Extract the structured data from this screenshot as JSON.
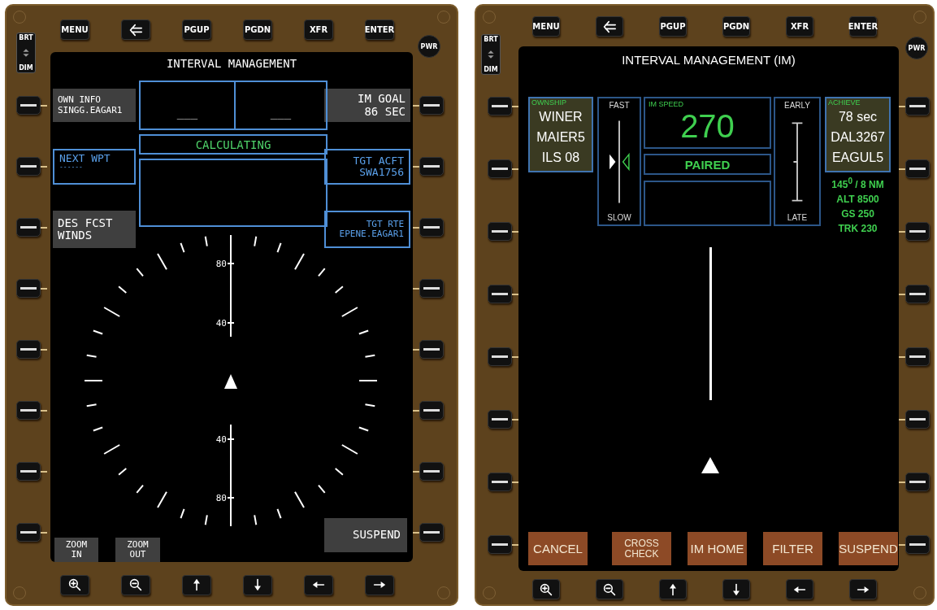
{
  "panels": [
    {
      "kind": "map",
      "brightness": [
        "BRT",
        "DIM"
      ],
      "power": "PWR",
      "top_keys": [
        {
          "kind": "text",
          "label": "MENU"
        },
        {
          "kind": "back"
        },
        {
          "kind": "text",
          "label": "PGUP"
        },
        {
          "kind": "text",
          "label": "PGDN"
        },
        {
          "kind": "text",
          "label": "XFR"
        },
        {
          "kind": "text",
          "label": "ENTER"
        }
      ],
      "bottom_keys": [
        {
          "kind": "zoom-in"
        },
        {
          "kind": "zoom-out"
        },
        {
          "kind": "up"
        },
        {
          "kind": "down"
        },
        {
          "kind": "left"
        },
        {
          "kind": "right"
        }
      ],
      "title": "INTERVAL MANAGEMENT",
      "left_labels": [
        {
          "kind": "filled",
          "lines": [
            "OWN INFO",
            "SINGG.EAGAR1"
          ]
        },
        {
          "kind": "outlined",
          "lines": [
            "NEXT WPT",
            "------"
          ]
        },
        {
          "kind": "filled",
          "lines": [
            "DES FCST",
            "WINDS"
          ]
        }
      ],
      "right_labels": [
        {
          "kind": "filled",
          "lines": [
            "IM GOAL",
            "86 SEC"
          ]
        },
        {
          "kind": "outlined",
          "lines": [
            "TGT ACFT",
            "SWA1756"
          ]
        },
        {
          "kind": "outlined",
          "lines": [
            "TGT RTE",
            "EPENE.EAGAR1"
          ]
        }
      ],
      "data_boxes": [
        "___",
        "___"
      ],
      "status": "CALCULATING",
      "range_labels": [
        "80",
        "40",
        "40",
        "80"
      ],
      "zoom_buttons": [
        [
          "ZOOM",
          "IN"
        ],
        [
          "ZOOM",
          "OUT"
        ]
      ],
      "suspend_button": "SUSPEND"
    },
    {
      "kind": "speed",
      "brightness": [
        "BRT",
        "DIM"
      ],
      "power": "PWR",
      "top_keys": [
        {
          "kind": "text",
          "label": "MENU"
        },
        {
          "kind": "back"
        },
        {
          "kind": "text",
          "label": "PGUP"
        },
        {
          "kind": "text",
          "label": "PGDN"
        },
        {
          "kind": "text",
          "label": "XFR"
        },
        {
          "kind": "text",
          "label": "ENTER"
        }
      ],
      "bottom_keys": [
        {
          "kind": "zoom-in"
        },
        {
          "kind": "zoom-out"
        },
        {
          "kind": "up"
        },
        {
          "kind": "down"
        },
        {
          "kind": "left"
        },
        {
          "kind": "right"
        }
      ],
      "title": "INTERVAL MANAGEMENT (IM)",
      "ownship": {
        "label": "OWNSHIP",
        "lines": [
          "WINER",
          "MAIER5",
          "ILS 08"
        ]
      },
      "speed_scale": {
        "top": "FAST",
        "bottom": "SLOW"
      },
      "im_speed": {
        "label": "IM SPEED",
        "value": "270"
      },
      "status": "PAIRED",
      "timing_scale": {
        "top": "EARLY",
        "bottom": "LATE"
      },
      "achieve": {
        "label": "ACHIEVE",
        "lines": [
          "78 sec",
          "DAL3267",
          "EAGUL5"
        ]
      },
      "target_details": [
        "145$^{0}$ / 8 NM",
        "ALT 8500",
        "GS 250",
        "TRK 230"
      ],
      "soft_buttons": [
        "CANCEL",
        "CROSS CHECK",
        "IM HOME",
        "FILTER",
        "SUSPEND"
      ]
    }
  ]
}
